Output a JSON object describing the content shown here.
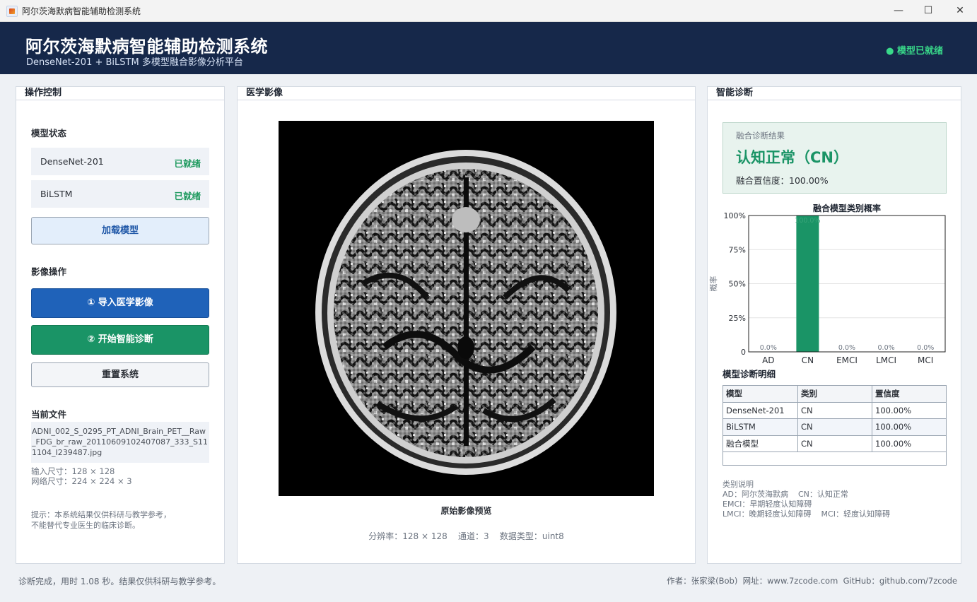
{
  "window": {
    "title": "阿尔茨海默病智能辅助检测系统",
    "controls": [
      "—",
      "☐",
      "✕"
    ]
  },
  "header": {
    "title": "阿尔茨海默病智能辅助检测系统",
    "subtitle": "DenseNet-201 + BiLSTM 多模型融合影像分析平台",
    "status": "● 模型已就绪",
    "status_color": "#39d98a"
  },
  "left": {
    "title": "操作控制",
    "model_status_label": "模型状态",
    "models": [
      {
        "name": "DenseNet-201",
        "status": "已就绪"
      },
      {
        "name": "BiLSTM",
        "status": "已就绪"
      }
    ],
    "load_button": "加载模型",
    "image_ops_label": "影像操作",
    "import_button": "① 导入医学影像",
    "diagnose_button": "② 开始智能诊断",
    "reset_button": "重置系统",
    "current_file_label": "当前文件",
    "file_name": "ADNI_002_S_0295_PT_ADNI_Brain_PET__Raw_FDG_br_raw_20110609102407087_333_S111104_I239487.jpg",
    "input_size": "输入尺寸：128 × 128",
    "net_size": "网络尺寸：224 × 224 × 3",
    "tip_line1": "提示：本系统结果仅供科研与教学参考，",
    "tip_line2": "不能替代专业医生的临床诊断。"
  },
  "center": {
    "title": "医学影像",
    "caption": "原始影像预览",
    "meta": "分辨率：128 × 128    通道：3    数据类型：uint8"
  },
  "right": {
    "title": "智能诊断",
    "result_label": "融合诊断结果",
    "result_value": "认知正常（CN）",
    "confidence": "融合置信度：100.00%",
    "result_color": "#1a9466",
    "table_title": "模型诊断明细",
    "table_headers": [
      "模型",
      "类别",
      "置信度"
    ],
    "table_rows": [
      [
        "DenseNet-201",
        "CN",
        "100.00%"
      ],
      [
        "BiLSTM",
        "CN",
        "100.00%"
      ],
      [
        "融合模型",
        "CN",
        "100.00%"
      ]
    ],
    "legend_title": "类别说明",
    "legend_line1": "AD：阿尔茨海默病    CN：认知正常",
    "legend_line2": "EMCI：早期轻度认知障碍",
    "legend_line3": "LMCI：晚期轻度认知障碍    MCI：轻度认知障碍"
  },
  "chart_data": {
    "type": "bar",
    "title": "融合模型类别概率",
    "ylabel": "概率",
    "xlabel": "",
    "categories": [
      "AD",
      "CN",
      "EMCI",
      "LMCI",
      "MCI"
    ],
    "values": [
      0,
      100,
      0,
      0,
      0
    ],
    "data_labels": [
      "0.0%",
      "100.0%",
      "0.0%",
      "0.0%",
      "0.0%"
    ],
    "yticks": [
      "0",
      "25%",
      "50%",
      "75%",
      "100%"
    ],
    "ylim": [
      0,
      100
    ],
    "grid": true,
    "bar_color": "#1a9466"
  },
  "footer": {
    "left": "诊断完成，用时 1.08 秒。结果仅供科研与教学参考。",
    "right": "作者：张家梁(Bob)  网址：www.7zcode.com  GitHub：github.com/7zcode"
  }
}
